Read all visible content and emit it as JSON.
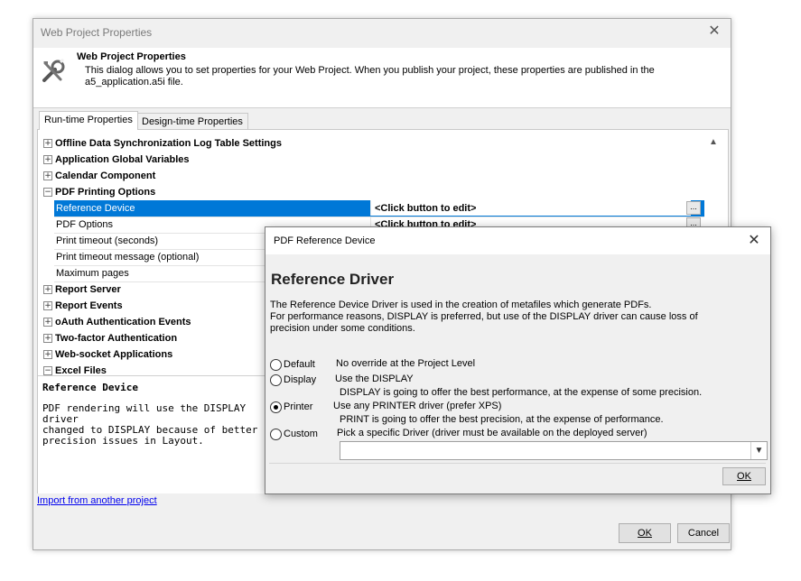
{
  "main": {
    "title": "Web Project Properties",
    "close_glyph": "✕",
    "heading": "Web Project Properties",
    "description": "This dialog allows you to set properties for your Web Project. When you publish your project, these properties are published in the a5_application.a5i file.",
    "icon": "tools-icon",
    "tabs": [
      {
        "label": "Run-time Properties",
        "active": true
      },
      {
        "label": "Design-time Properties",
        "active": false
      }
    ],
    "tree": [
      {
        "label": "Offline Data Synchronization Log Table Settings",
        "expander": "+"
      },
      {
        "label": "Application Global Variables",
        "expander": "+"
      },
      {
        "label": "Calendar Component",
        "expander": "+"
      },
      {
        "label": "PDF Printing Options",
        "expander": "−"
      },
      {
        "label": "Report Server",
        "expander": "+"
      },
      {
        "label": "Report Events",
        "expander": "+"
      },
      {
        "label": "oAuth Authentication Events",
        "expander": "+"
      },
      {
        "label": "Two-factor Authentication",
        "expander": "+"
      },
      {
        "label": "Web-socket Applications",
        "expander": "+"
      },
      {
        "label": "Excel Files",
        "expander": "−"
      }
    ],
    "pdf_children": [
      {
        "label": "Reference Device",
        "value": "<Click button to edit>",
        "selected": true
      },
      {
        "label": "PDF Options",
        "value": "<Click button to edit>",
        "selected": false
      },
      {
        "label": "Print timeout (seconds)",
        "value": "",
        "selected": false
      },
      {
        "label": "Print timeout message (optional)",
        "value": "",
        "selected": false
      },
      {
        "label": "Maximum pages",
        "value": "",
        "selected": false
      }
    ],
    "ellipsis": "...",
    "scroll_up_glyph": "▲",
    "desc_title": "Reference Device",
    "desc_text": "PDF rendering will use the DISPLAY driver\nchanged to DISPLAY because of better per\nprecision issues in Layout.",
    "import_link": "Import from another project",
    "ok": "OK",
    "cancel": "Cancel"
  },
  "overlay": {
    "title": "PDF Reference Device",
    "close_glyph": "✕",
    "heading": "Reference Driver",
    "desc_line1": "The Reference Device Driver is used in the creation of metafiles which generate PDFs.",
    "desc_line2": "For performance reasons, DISPLAY is preferred, but use of the DISPLAY driver can cause loss of",
    "desc_line3": "precision under some conditions.",
    "options": [
      {
        "label": "Default",
        "desc": "No override at the Project Level",
        "sub": "",
        "selected": false
      },
      {
        "label": "Display",
        "desc": "Use the DISPLAY",
        "sub": "DISPLAY is going to offer the best performance, at the expense of some precision.",
        "selected": false
      },
      {
        "label": "Printer",
        "desc": "Use any PRINTER driver (prefer XPS)",
        "sub": "PRINT is going to offer the best precision, at the expense of performance.",
        "selected": true
      },
      {
        "label": "Custom",
        "desc": "Pick a specific Driver (driver must be available on the deployed server)",
        "sub": "",
        "selected": false
      }
    ],
    "driver_value": "",
    "dropdown_glyph": "▼",
    "ok": "OK"
  }
}
